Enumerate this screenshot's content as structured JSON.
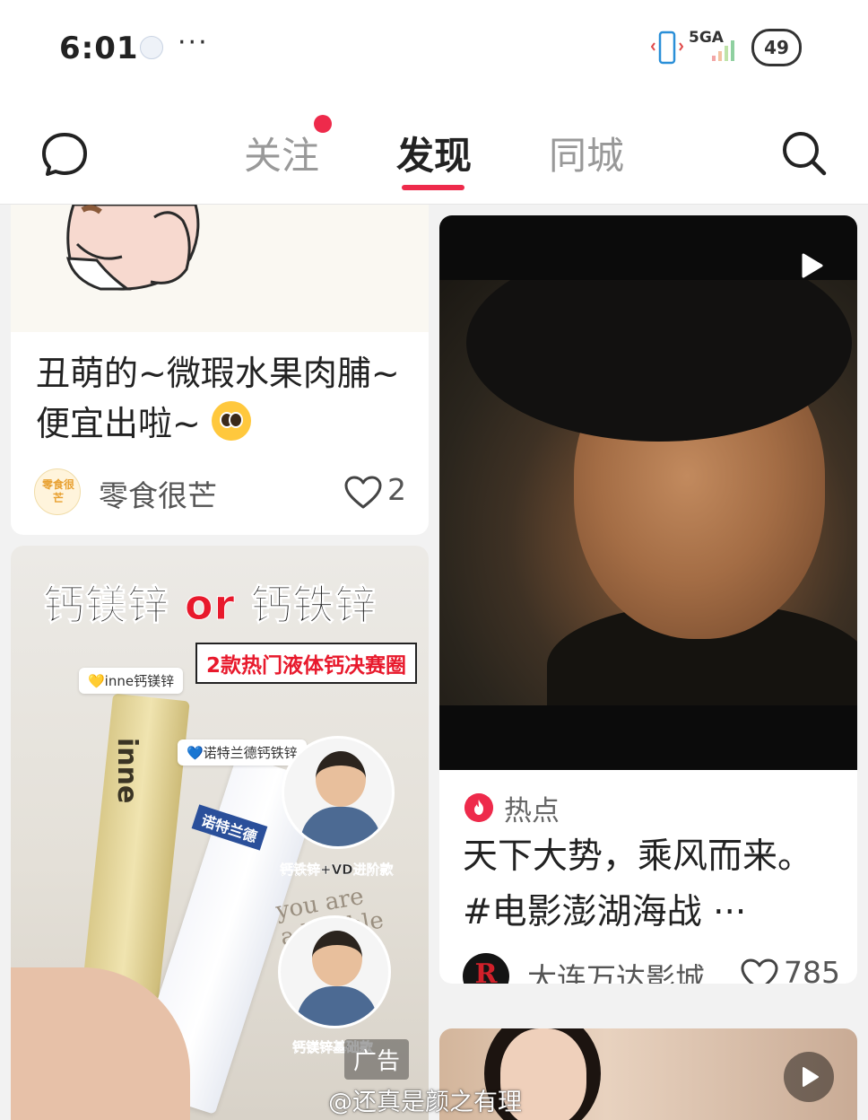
{
  "status_bar": {
    "time": "6:01",
    "dots": "···",
    "network": "5GA",
    "battery": "49"
  },
  "nav": {
    "tabs": [
      {
        "label": "关注",
        "has_dot": true
      },
      {
        "label": "发现",
        "active": true
      },
      {
        "label": "同城"
      }
    ]
  },
  "feed": {
    "cards": [
      {
        "title": "丑萌的~微瑕水果肉脯~便宜出啦~",
        "author": "零食很芒",
        "author_avatar_text": "零食很芒",
        "likes": "2"
      },
      {
        "ad_headline_a": "钙镁锌",
        "ad_headline_or": "or",
        "ad_headline_b": "钙铁锌",
        "ad_subtitle": "2款热门液体钙决赛圈",
        "tag_1": "💛inne钙镁锌",
        "tag_2": "💙诺特兰德钙铁锌",
        "stick_1": "inne",
        "stick_2": "诺特兰德",
        "kid_label_1": "钙铁锌+VD进阶款",
        "kid_label_2": "钙镁锌基础款",
        "script_text": "you are adorable baby",
        "ad_label": "广告"
      },
      {
        "badge": "热点",
        "title": "天下大势，乘风而来。#电影澎湖海战 ···",
        "author": "大连万达影城",
        "author_avatar_text": "R",
        "likes": "785"
      },
      {}
    ]
  },
  "watermark": "@还真是颜之有理",
  "colors": {
    "accent": "#ee2a4b",
    "background": "#f2f2f2",
    "card": "#ffffff"
  }
}
